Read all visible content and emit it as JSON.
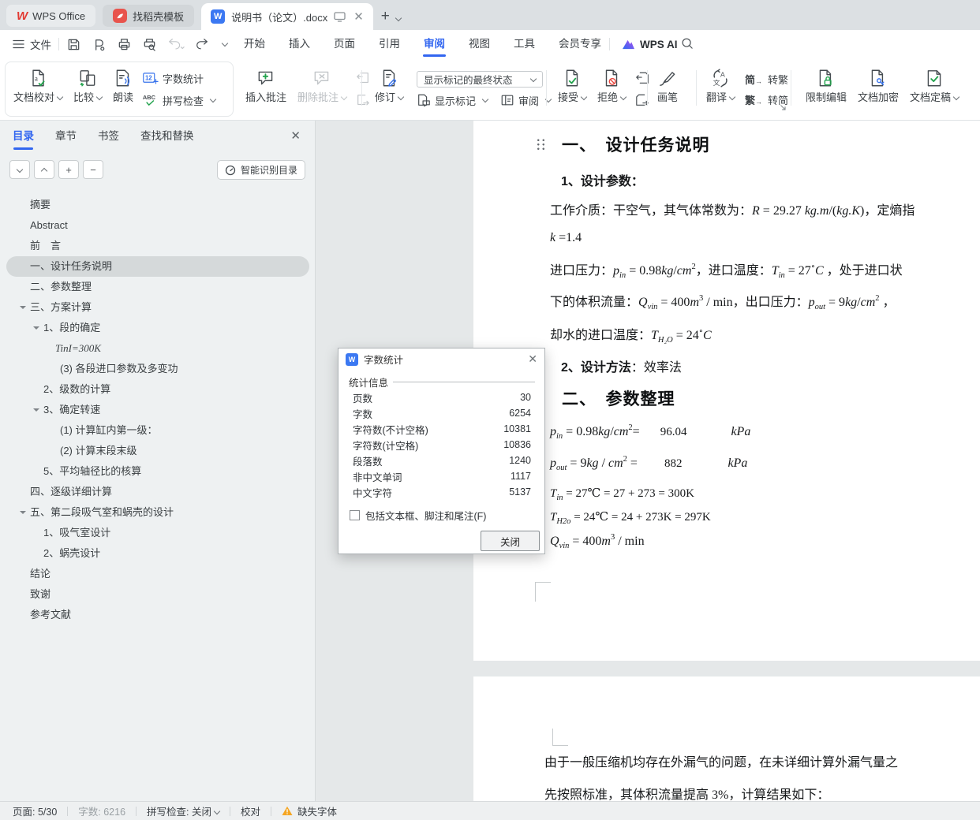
{
  "tabbar": {
    "wps": "WPS Office",
    "docer": "找稻壳模板",
    "doc": "说明书（论文）.docx"
  },
  "menubar": {
    "file": "文件",
    "menus": [
      "开始",
      "插入",
      "页面",
      "引用",
      "审阅",
      "视图",
      "工具",
      "会员专享"
    ],
    "active_index": 4,
    "wps_ai": "WPS AI"
  },
  "ribbon": {
    "doc_proof": "文档校对",
    "compare": "比较",
    "read_aloud": "朗读",
    "word_count": "字数统计",
    "spell_check": "拼写检查",
    "insert_comment": "插入批注",
    "delete_comment": "删除批注",
    "revise": "修订",
    "markup_state": "显示标记的最终状态",
    "show_markup": "显示标记",
    "review": "审阅",
    "accept": "接受",
    "reject": "拒绝",
    "pen": "画笔",
    "translate": "翻译",
    "jian": "简",
    "fan": "繁",
    "to_trad": "转繁",
    "to_simp": "转简",
    "restrict_edit": "限制编辑",
    "encrypt": "文档加密",
    "finalize": "文档定稿"
  },
  "sidebar": {
    "tabs": [
      "目录",
      "章节",
      "书签",
      "查找和替换"
    ],
    "smart_toc": "智能识别目录",
    "outline": [
      {
        "label": "摘要",
        "level": 0
      },
      {
        "label": "Abstract",
        "level": 0
      },
      {
        "label": "前　言",
        "level": 0
      },
      {
        "label": "一、设计任务说明",
        "level": 0,
        "selected": true
      },
      {
        "label": "二、参数整理",
        "level": 0
      },
      {
        "label": "三、方案计算",
        "level": 0,
        "arrow": true
      },
      {
        "label": "1、段的确定",
        "level": 1,
        "arrow": true
      },
      {
        "label": "TinI=300K",
        "level": 2,
        "italic": true
      },
      {
        "label": "(3) 各段进口参数及多变功",
        "level": 2
      },
      {
        "label": "2、级数的计算",
        "level": 1
      },
      {
        "label": "3、确定转速",
        "level": 1,
        "arrow": true
      },
      {
        "label": "(1) 计算缸内第一级：",
        "level": 2
      },
      {
        "label": "(2) 计算末段末级",
        "level": 2
      },
      {
        "label": "5、平均轴径比的核算",
        "level": 1
      },
      {
        "label": "四、逐级详细计算",
        "level": 0
      },
      {
        "label": "五、第二段吸气室和蜗壳的设计",
        "level": 0,
        "arrow": true
      },
      {
        "label": "1、吸气室设计",
        "level": 1
      },
      {
        "label": "2、蜗壳设计",
        "level": 1
      },
      {
        "label": "结论",
        "level": 0
      },
      {
        "label": "致谢",
        "level": 0
      },
      {
        "label": "参考文献",
        "level": 0
      }
    ]
  },
  "dialog": {
    "title": "字数统计",
    "section": "统计信息",
    "rows": [
      {
        "label": "页数",
        "value": "30"
      },
      {
        "label": "字数",
        "value": "6254"
      },
      {
        "label": "字符数(不计空格)",
        "value": "10381"
      },
      {
        "label": "字符数(计空格)",
        "value": "10836"
      },
      {
        "label": "段落数",
        "value": "1240"
      },
      {
        "label": "非中文单词",
        "value": "1117"
      },
      {
        "label": "中文字符",
        "value": "5137"
      }
    ],
    "checkbox": "包括文本框、脚注和尾注(F)",
    "close": "关闭"
  },
  "document": {
    "h1": "一、　设计任务说明",
    "s1": "1、设计参数：",
    "l3": [
      {
        "t": "cn",
        "v": "工作介质：干空气，其气体常数为："
      },
      {
        "t": "var",
        "v": "R"
      },
      {
        "t": "tx",
        "v": " = 29.27 "
      },
      {
        "t": "var",
        "v": "kg.m"
      },
      {
        "t": "tx",
        "v": "/("
      },
      {
        "t": "var",
        "v": "kg.K"
      },
      {
        "t": "tx",
        "v": ")"
      },
      {
        "t": "cn",
        "v": "，定熵指"
      }
    ],
    "l4": [
      {
        "t": "var",
        "v": "k"
      },
      {
        "t": "tx",
        "v": " =1.4"
      }
    ],
    "l5": [
      {
        "t": "cn",
        "v": "进口压力："
      },
      {
        "t": "var",
        "v": "p"
      },
      {
        "t": "sub",
        "v": "in"
      },
      {
        "t": "tx",
        "v": " = 0.98"
      },
      {
        "t": "var",
        "v": "kg"
      },
      {
        "t": "tx",
        "v": "/"
      },
      {
        "t": "var",
        "v": "cm"
      },
      {
        "t": "sup",
        "v": "2"
      },
      {
        "t": "cn",
        "v": "，进口温度："
      },
      {
        "t": "var",
        "v": "T"
      },
      {
        "t": "sub",
        "v": "in"
      },
      {
        "t": "tx",
        "v": " = 27"
      },
      {
        "t": "sup",
        "v": "∘"
      },
      {
        "t": "var",
        "v": "C"
      },
      {
        "t": "cn",
        "v": " ，处于进口状"
      }
    ],
    "l6": [
      {
        "t": "cn",
        "v": "下的体积流量："
      },
      {
        "t": "var",
        "v": "Q"
      },
      {
        "t": "sub",
        "v": "vin"
      },
      {
        "t": "tx",
        "v": " = 400"
      },
      {
        "t": "var",
        "v": "m"
      },
      {
        "t": "sup",
        "v": "3"
      },
      {
        "t": "tx",
        "v": " / min"
      },
      {
        "t": "cn",
        "v": "，出口压力："
      },
      {
        "t": "var",
        "v": "p"
      },
      {
        "t": "sub",
        "v": "out"
      },
      {
        "t": "tx",
        "v": " = 9"
      },
      {
        "t": "var",
        "v": "kg"
      },
      {
        "t": "tx",
        "v": "/"
      },
      {
        "t": "var",
        "v": "cm"
      },
      {
        "t": "sup",
        "v": "2"
      },
      {
        "t": "cn",
        "v": " ，"
      }
    ],
    "l7": [
      {
        "t": "cn",
        "v": "却水的进口温度："
      },
      {
        "t": "var",
        "v": "T"
      },
      {
        "t": "sub",
        "v": "H₂O"
      },
      {
        "t": "tx",
        "v": " = 24"
      },
      {
        "t": "sup",
        "v": "∘"
      },
      {
        "t": "var",
        "v": "C"
      }
    ],
    "l8": [
      {
        "t": "cnb",
        "v": "2、设计方法"
      },
      {
        "t": "cn",
        "v": "：效率法"
      }
    ],
    "h2": "二、　参数整理",
    "f1": [
      {
        "t": "var",
        "v": "p"
      },
      {
        "t": "sub",
        "v": "in"
      },
      {
        "t": "tx",
        "v": " = 0.98"
      },
      {
        "t": "var",
        "v": "kg"
      },
      {
        "t": "tx",
        "v": "/"
      },
      {
        "t": "var",
        "v": "cm"
      },
      {
        "t": "sup",
        "v": "2"
      },
      {
        "t": "tx",
        "v": "="
      },
      {
        "t": "num",
        "v": "96.04",
        "ml": 26
      },
      {
        "t": "var",
        "v": "kPa",
        "ml": 56
      }
    ],
    "f2": [
      {
        "t": "var",
        "v": "p"
      },
      {
        "t": "sub",
        "v": "out"
      },
      {
        "t": "tx",
        "v": " = 9"
      },
      {
        "t": "var",
        "v": "kg"
      },
      {
        "t": "tx",
        "v": " / "
      },
      {
        "t": "var",
        "v": "cm"
      },
      {
        "t": "sup",
        "v": "2"
      },
      {
        "t": "tx",
        "v": " ="
      },
      {
        "t": "num",
        "v": "882",
        "ml": 34
      },
      {
        "t": "var",
        "v": "kPa",
        "ml": 58
      }
    ],
    "f3": [
      {
        "t": "var",
        "v": "T"
      },
      {
        "t": "sub",
        "v": "in"
      },
      {
        "t": "tx",
        "v": " = 27℃ = 27 + 273 = 300K"
      }
    ],
    "f4": [
      {
        "t": "var",
        "v": "T"
      },
      {
        "t": "sub",
        "v": "H2o"
      },
      {
        "t": "tx",
        "v": " = 24℃ = 24 + 273K = 297K"
      }
    ],
    "f5": [
      {
        "t": "var",
        "v": "Q"
      },
      {
        "t": "sub",
        "v": "vin"
      },
      {
        "t": "tx",
        "v": " = 400"
      },
      {
        "t": "var",
        "v": "m"
      },
      {
        "t": "sup",
        "v": "3"
      },
      {
        "t": "tx",
        "v": " / min"
      }
    ],
    "p2l1": "由于一般压缩机均存在外漏气的问题，在未详细计算外漏气量之",
    "p2l2": "先按照标准，其体积流量提高 3%，计算结果如下："
  },
  "statusbar": {
    "page": "页面: 5/30",
    "words": "字数: 6216",
    "spell": "拼写检查: 关闭",
    "proof": "校对",
    "missing_font": "缺失字体"
  }
}
